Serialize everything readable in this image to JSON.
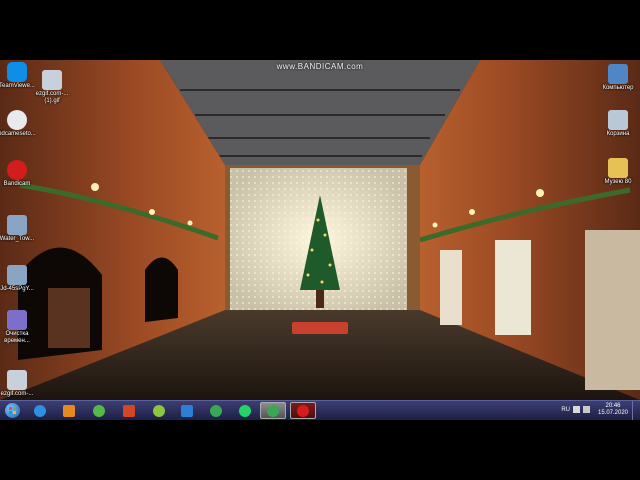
{
  "recorder": {
    "watermark": "www.BANDICAM.com"
  },
  "desktop": {
    "icons_left": [
      {
        "label": "TeamViewe...",
        "icon": "teamviewer-icon",
        "color": "#0e8ee9"
      },
      {
        "label": "ezgif.com-...\n(1).gif",
        "icon": "gif-file-icon",
        "color": "#c8d0dc"
      },
      {
        "label": "bdcameseto...",
        "icon": "bandicam-settings-icon",
        "color": "#e8eaee"
      },
      {
        "label": "Bandicam",
        "icon": "bandicam-icon",
        "color": "#d41c1c"
      },
      {
        "label": "Water_Tow...",
        "icon": "image-file-icon",
        "color": "#8aa4c4"
      },
      {
        "label": "Jd-45sPgY...",
        "icon": "image-file-icon",
        "color": "#8aa4c4"
      },
      {
        "label": "Очистка\nвремен...",
        "icon": "cleanup-icon",
        "color": "#7b6fc9"
      },
      {
        "label": "ezgif.com-...",
        "icon": "gif-file-icon",
        "color": "#c8d0dc"
      }
    ],
    "icons_right": [
      {
        "label": "Компьютер",
        "icon": "computer-icon",
        "color": "#4f86c6"
      },
      {
        "label": "Корзина",
        "icon": "recycle-bin-icon",
        "color": "#b9c7d6"
      },
      {
        "label": "Музею 80",
        "icon": "folder-icon",
        "color": "#e6c256"
      }
    ]
  },
  "taskbar": {
    "start_icon": "windows-start-icon",
    "pinned": [
      {
        "icon": "internet-explorer-icon",
        "color": "#2d8fe0"
      },
      {
        "icon": "media-player-icon",
        "color": "#e58a1e"
      },
      {
        "icon": "utorrent-icon",
        "color": "#56b848"
      },
      {
        "icon": "powerpoint-icon",
        "color": "#d24726"
      },
      {
        "icon": "add-plus-icon",
        "color": "#8cc63f"
      },
      {
        "icon": "photoshop-icon",
        "color": "#2d7fd3"
      },
      {
        "icon": "chrome-icon",
        "color": "#3aa757"
      },
      {
        "icon": "whatsapp-icon",
        "color": "#25d366"
      },
      {
        "icon": "chrome-active-icon",
        "color": "#3aa757"
      },
      {
        "icon": "bandicam-record-icon",
        "color": "#d41c1c"
      }
    ],
    "tray": {
      "language": "RU",
      "time": "20:46",
      "date": "15.07.2020"
    }
  }
}
